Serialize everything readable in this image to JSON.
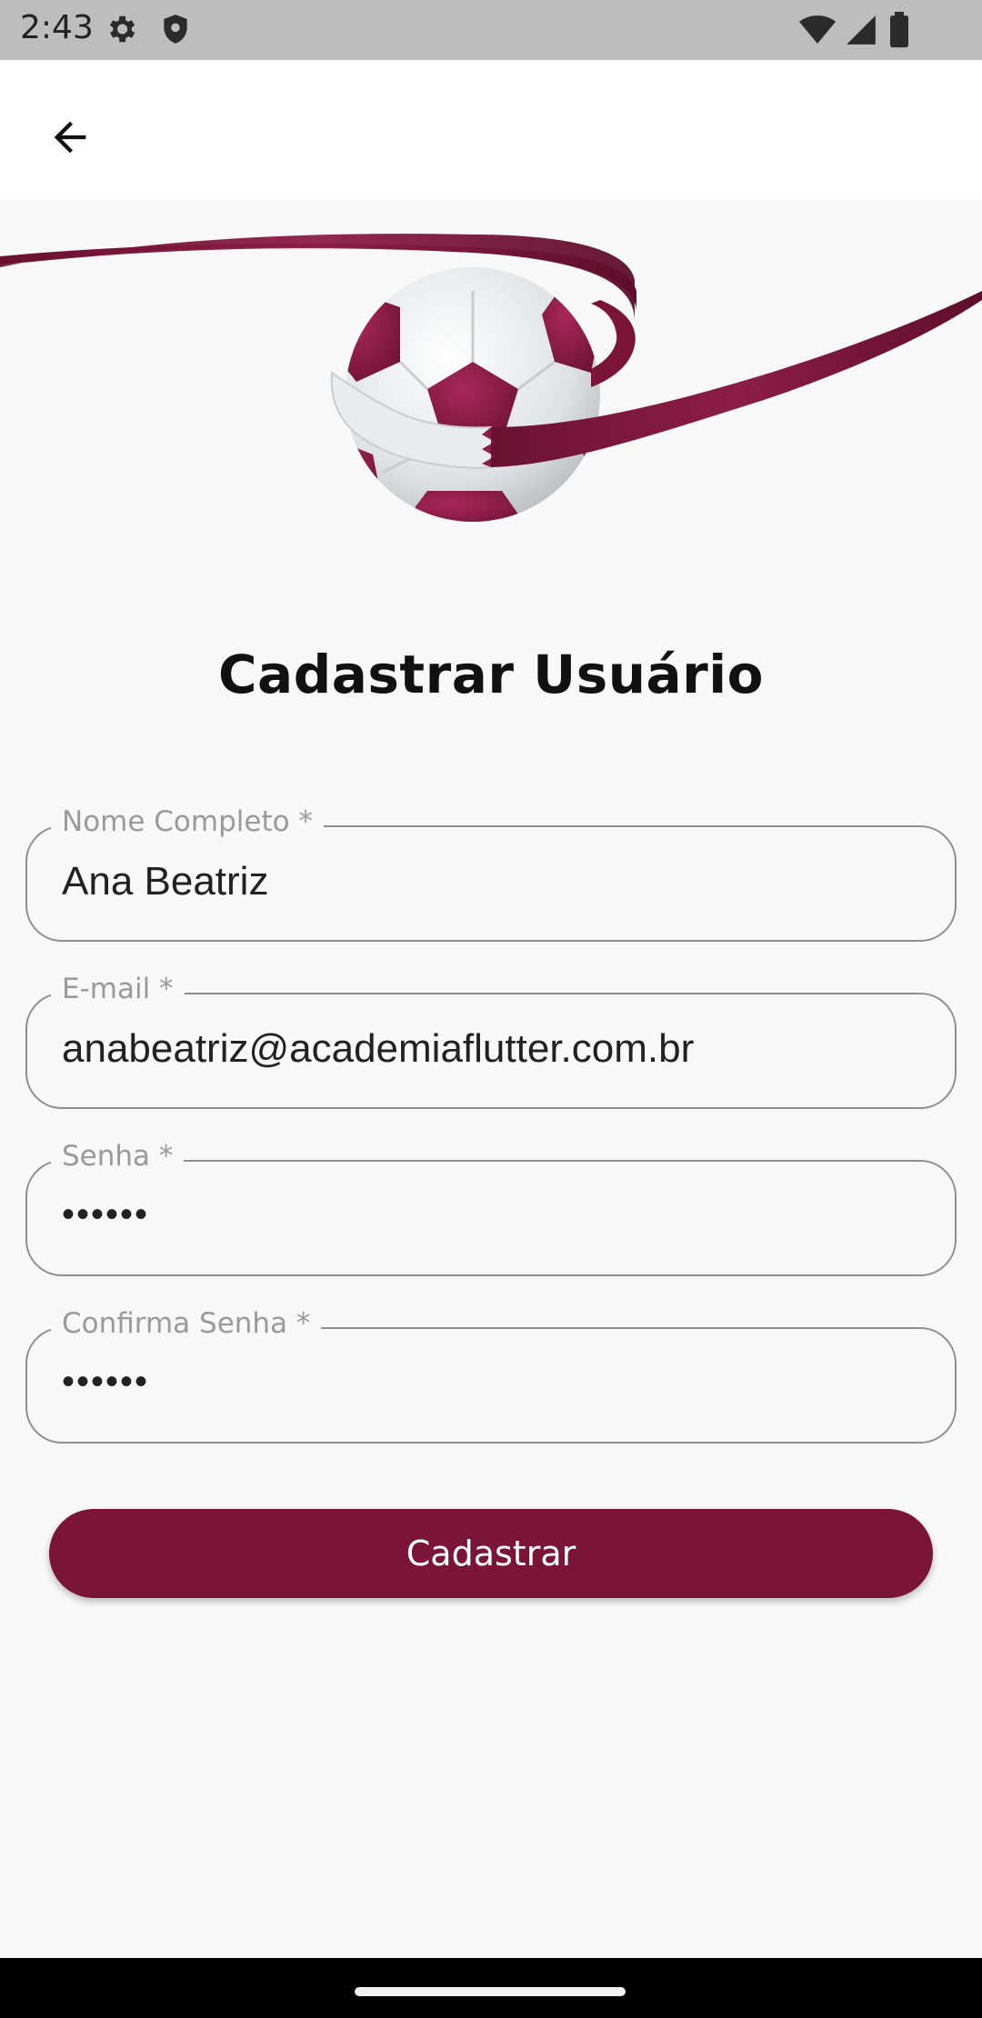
{
  "status_bar": {
    "time": "2:43",
    "icons": [
      "gear-icon",
      "shield-icon",
      "wifi-icon",
      "signal-icon",
      "battery-icon"
    ]
  },
  "app_bar": {
    "back_icon": "arrow-back-icon"
  },
  "hero": {
    "image": "soccer-ball-ribbon-logo",
    "ribbon_color": "#7a1538"
  },
  "page": {
    "title": "Cadastrar Usuário"
  },
  "form": {
    "name": {
      "label": "Nome Completo *",
      "value": "Ana Beatriz"
    },
    "email": {
      "label": "E-mail *",
      "value": "anabeatriz@academiaflutter.com.br"
    },
    "password": {
      "label": "Senha *",
      "value": "••••••"
    },
    "confirm_password": {
      "label": "Confirma Senha *",
      "value": "••••••"
    },
    "submit_label": "Cadastrar"
  },
  "colors": {
    "accent": "#7a1538",
    "background": "#f8f8f8",
    "app_bar": "#ffffff",
    "status_bar": "#bdbdbd"
  }
}
